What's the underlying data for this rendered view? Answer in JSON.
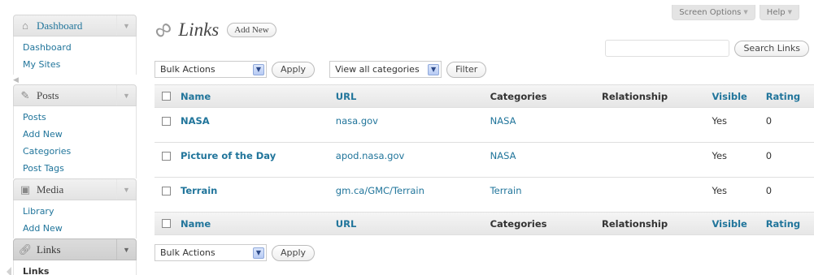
{
  "screen_meta": {
    "screen_options": "Screen Options",
    "help": "Help"
  },
  "sidebar": {
    "dashboard": {
      "label": "Dashboard",
      "items": [
        "Dashboard",
        "My Sites"
      ]
    },
    "posts": {
      "label": "Posts",
      "items": [
        "Posts",
        "Add New",
        "Categories",
        "Post Tags"
      ]
    },
    "media": {
      "label": "Media",
      "items": [
        "Library",
        "Add New"
      ]
    },
    "links": {
      "label": "Links",
      "items": [
        "Links"
      ]
    }
  },
  "page": {
    "title": "Links",
    "add_new": "Add New"
  },
  "search": {
    "button": "Search Links",
    "value": ""
  },
  "tablenav_top": {
    "bulk_actions": "Bulk Actions",
    "apply": "Apply",
    "categories": "View all categories",
    "filter": "Filter"
  },
  "tablenav_bottom": {
    "bulk_actions": "Bulk Actions",
    "apply": "Apply"
  },
  "table": {
    "columns": [
      "Name",
      "URL",
      "Categories",
      "Relationship",
      "Visible",
      "Rating"
    ],
    "rows": [
      {
        "name": "NASA",
        "url": "nasa.gov",
        "categories": "NASA",
        "relationship": "",
        "visible": "Yes",
        "rating": "0"
      },
      {
        "name": "Picture of the Day",
        "url": "apod.nasa.gov",
        "categories": "NASA",
        "relationship": "",
        "visible": "Yes",
        "rating": "0"
      },
      {
        "name": "Terrain",
        "url": "gm.ca/GMC/Terrain",
        "categories": "Terrain",
        "relationship": "",
        "visible": "Yes",
        "rating": "0"
      }
    ]
  },
  "colors": {
    "link": "#21759b",
    "header_bg": "#e6e6e6"
  }
}
